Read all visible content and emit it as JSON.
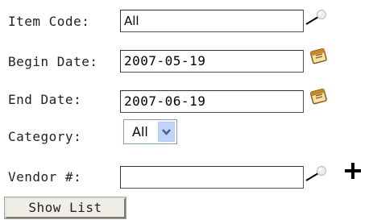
{
  "form": {
    "item_code": {
      "label": "Item Code:",
      "value": "All"
    },
    "begin_date": {
      "label": "Begin Date:",
      "value": "2007-05-19"
    },
    "end_date": {
      "label": "End Date:",
      "value": "2007-06-19"
    },
    "category": {
      "label": "Category:",
      "selected": "All"
    },
    "vendor": {
      "label": "Vendor #:",
      "value": ""
    },
    "show_list_label": "Show List"
  },
  "icons": {
    "lookup": "magnifier-search-icon",
    "calendar": "calendar-icon",
    "add": "plus-icon",
    "dropdown": "chevron-down-icon"
  },
  "colors": {
    "dropdown_button": "#c1d3fb",
    "dropdown_arrow": "#4d6185",
    "calendar_accent": "#c8872c"
  }
}
